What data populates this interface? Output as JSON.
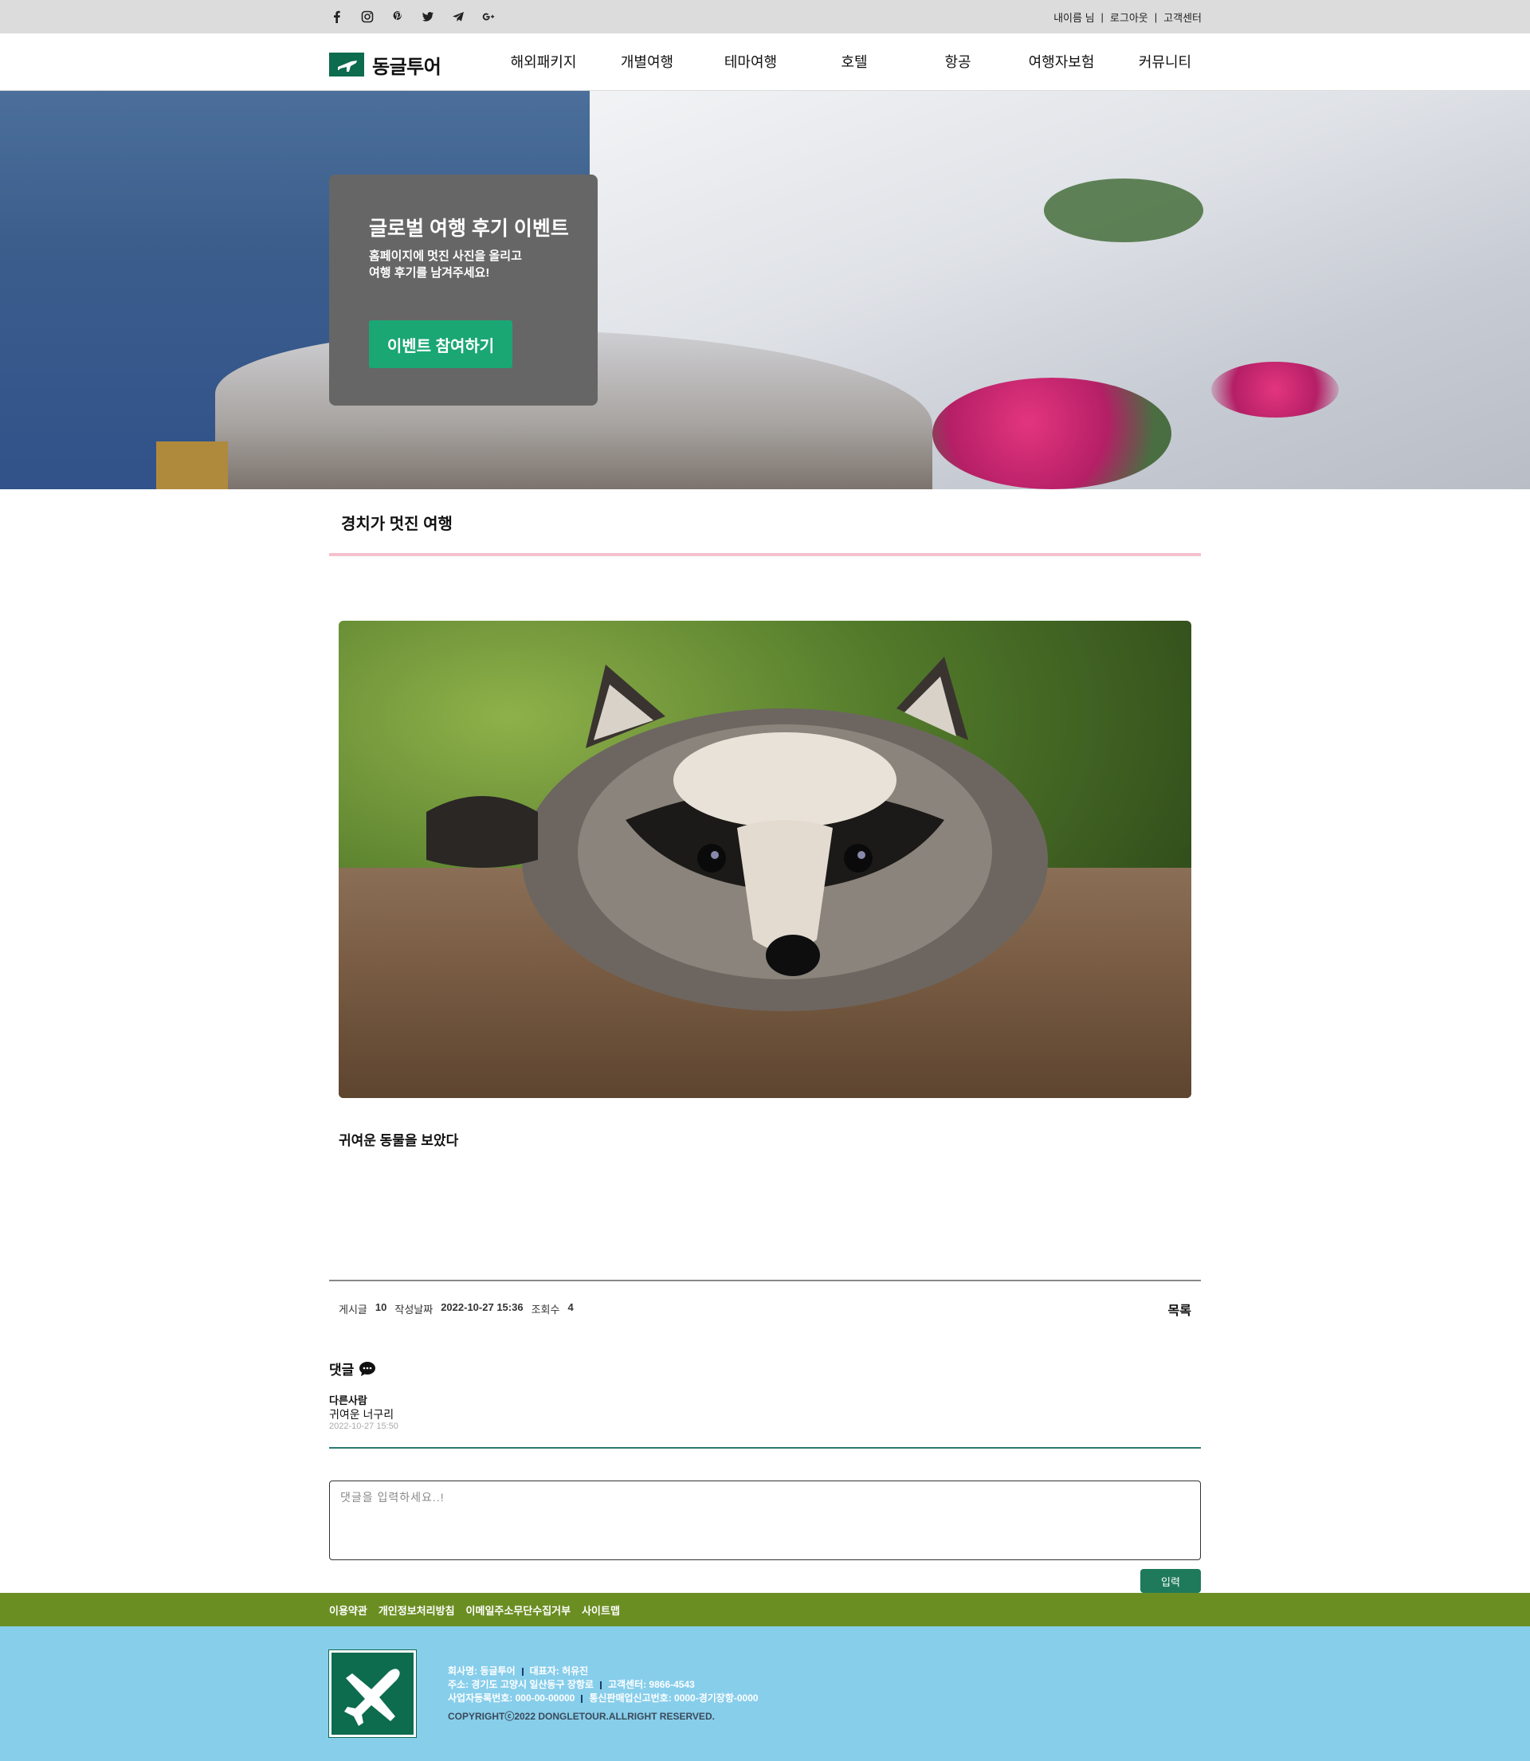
{
  "topbar": {
    "social": [
      "facebook-icon",
      "instagram-icon",
      "pinterest-icon",
      "twitter-icon",
      "telegram-icon",
      "google-plus-icon"
    ],
    "user_label": "내이름 님",
    "logout_label": "로그아웃",
    "support_label": "고객센터"
  },
  "header": {
    "logo_text": "동글투어",
    "nav": [
      "해외패키지",
      "개별여행",
      "테마여행",
      "호텔",
      "항공",
      "여행자보험",
      "커뮤니티"
    ]
  },
  "hero": {
    "title": "글로벌 여행 후기 이벤트",
    "subtitle_line1": "홈페이지에 멋진 사진을 올리고",
    "subtitle_line2": "여행 후기를 남겨주세요!",
    "button_label": "이벤트 참여하기"
  },
  "post": {
    "title": "경치가 멋진 여행",
    "body": "귀여운 동물을 보았다",
    "meta": {
      "post_label": "게시글",
      "post_number": "10",
      "date_label": "작성날짜",
      "date": "2022-10-27 15:36",
      "views_label": "조회수",
      "views": "4"
    },
    "list_label": "목록"
  },
  "comments": {
    "heading": "댓글",
    "items": [
      {
        "user": "다른사람",
        "text": "귀여운 너구리",
        "date": "2022-10-27 15:50"
      }
    ],
    "input_placeholder": "댓글을 입력하세요..!",
    "submit_label": "입력"
  },
  "footer": {
    "links": [
      "이용약관",
      "개인정보처리방침",
      "이메일주소무단수집거부",
      "사이트맵"
    ],
    "company": "회사명: 동글투어",
    "ceo": "대표자: 허유진",
    "address": "주소: 경기도 고양시 일산동구 장항로",
    "phone": "고객센터: 9866-4543",
    "biz_no": "사업자등록번호: 000-00-00000",
    "mail_order_no": "통신판매업신고번호: 0000-경기장항-0000",
    "copyright": "COPYRIGHTⓒ2022 DONGLETOUR.ALLRIGHT RESERVED."
  },
  "colors": {
    "accent_green": "#1aa774",
    "brand_green": "#0d6b4e",
    "footer_bar": "#6b8e23",
    "footer_bg": "#87ceeb",
    "title_underline": "#f4c0cd"
  }
}
